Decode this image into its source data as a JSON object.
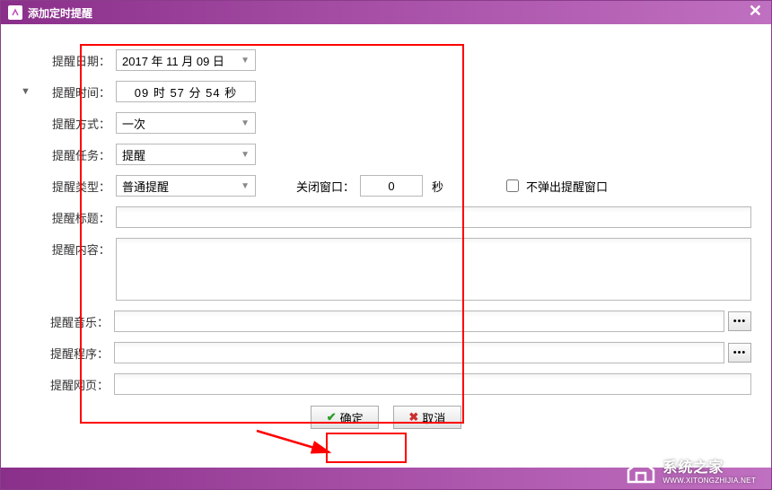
{
  "window": {
    "title": "添加定时提醒"
  },
  "fields": {
    "date": {
      "label": "提醒日期：",
      "value": "2017 年 11 月 09 日"
    },
    "time": {
      "label": "提醒时间：",
      "prefix": "▼",
      "value": "09 时 57 分 54 秒"
    },
    "mode": {
      "label": "提醒方式：",
      "value": "一次"
    },
    "task": {
      "label": "提醒任务：",
      "value": "提醒"
    },
    "type": {
      "label": "提醒类型：",
      "value": "普通提醒"
    },
    "close_window": {
      "label": "关闭窗口：",
      "value": "0",
      "unit": "秒"
    },
    "no_popup": {
      "label": "不弹出提醒窗口",
      "checked": false
    },
    "title": {
      "label": "提醒标题：",
      "value": ""
    },
    "content": {
      "label": "提醒内容：",
      "value": ""
    },
    "music": {
      "label": "提醒音乐：",
      "value": ""
    },
    "program": {
      "label": "提醒程序：",
      "value": ""
    },
    "webpage": {
      "label": "提醒网页：",
      "value": ""
    }
  },
  "buttons": {
    "ok": "确定",
    "cancel": "取消",
    "browse": "•••"
  },
  "watermark": {
    "brand": "系统之家",
    "url": "WWW.XITONGZHIJIA.NET"
  }
}
